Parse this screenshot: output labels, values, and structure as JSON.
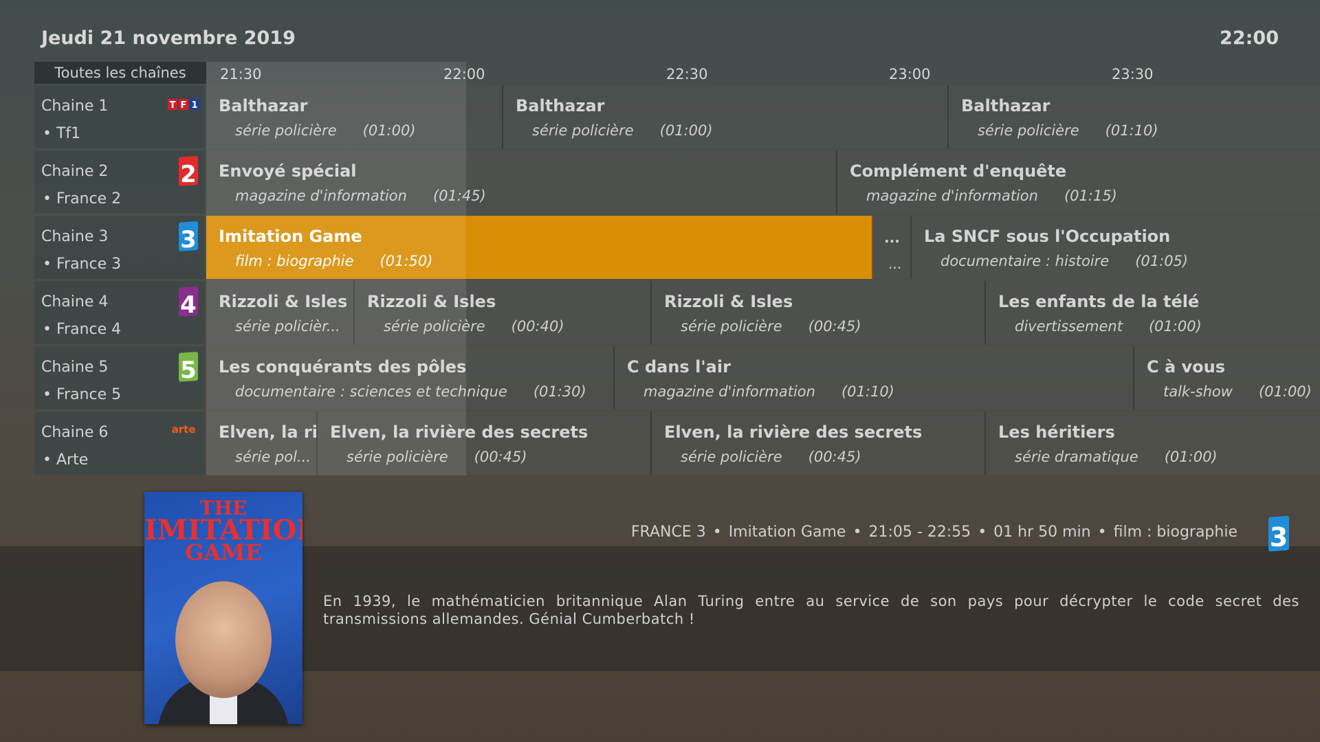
{
  "header": {
    "date": "Jeudi 21 novembre 2019",
    "clock": "22:00"
  },
  "filter": {
    "label": "Toutes les chaînes"
  },
  "timeline": [
    "21:30",
    "22:00",
    "22:30",
    "23:00",
    "23:30"
  ],
  "channels": [
    {
      "number": "Chaine 1",
      "name": "• Tf1",
      "logo": "tf1-logo",
      "logo_text": "TF1"
    },
    {
      "number": "Chaine 2",
      "name": "• France 2",
      "logo": "france2-logo",
      "logo_text": "2"
    },
    {
      "number": "Chaine 3",
      "name": "• France 3",
      "logo": "france3-logo",
      "logo_text": "3"
    },
    {
      "number": "Chaine 4",
      "name": "• France 4",
      "logo": "france4-logo",
      "logo_text": "4"
    },
    {
      "number": "Chaine 5",
      "name": "• France 5",
      "logo": "france5-logo",
      "logo_text": "5"
    },
    {
      "number": "Chaine 6",
      "name": "• Arte",
      "logo": "arte-logo",
      "logo_text": "arte"
    }
  ],
  "programs": {
    "ch1": [
      {
        "title": "Balthazar",
        "genre": "série policière",
        "duration": "(01:00)"
      },
      {
        "title": "Balthazar",
        "genre": "série policière",
        "duration": "(01:00)"
      },
      {
        "title": "Balthazar",
        "genre": "série policière",
        "duration": "(01:10)"
      }
    ],
    "ch2": [
      {
        "title": "Envoyé spécial",
        "genre": "magazine d'information",
        "duration": "(01:45)"
      },
      {
        "title": "Complément d'enquête",
        "genre": "magazine d'information",
        "duration": "(01:15)"
      }
    ],
    "ch3": [
      {
        "title": "Imitation Game",
        "genre": "film : biographie",
        "duration": "(01:50)"
      },
      {
        "title": "...",
        "genre": "..."
      },
      {
        "title": "La SNCF sous l'Occupation",
        "genre": "documentaire : histoire",
        "duration": "(01:05)"
      }
    ],
    "ch4": [
      {
        "title": "Rizzoli & Isles",
        "genre": "série policièr..."
      },
      {
        "title": "Rizzoli & Isles",
        "genre": "série policière",
        "duration": "(00:40)"
      },
      {
        "title": "Rizzoli & Isles",
        "genre": "série policière",
        "duration": "(00:45)"
      },
      {
        "title": "Les enfants de la télé",
        "genre": "divertissement",
        "duration": "(01:00)"
      }
    ],
    "ch5": [
      {
        "title": "Les conquérants des pôles",
        "genre": "documentaire : sciences et technique",
        "duration": "(01:30)"
      },
      {
        "title": "C dans l'air",
        "genre": "magazine d'information",
        "duration": "(01:10)"
      },
      {
        "title": "C à vous",
        "genre": "talk-show",
        "duration": "(01:00)"
      }
    ],
    "ch6": [
      {
        "title": "Elven, la ri...",
        "genre": "série pol..."
      },
      {
        "title": "Elven, la rivière des secrets",
        "genre": "série policière",
        "duration": "(00:45)"
      },
      {
        "title": "Elven, la rivière des secrets",
        "genre": "série policière",
        "duration": "(00:45)"
      },
      {
        "title": "Les héritiers",
        "genre": "série dramatique",
        "duration": "(01:00)"
      }
    ]
  },
  "details": {
    "channel": "FRANCE 3",
    "title": "Imitation Game",
    "time": "21:05 - 22:55",
    "length": "01 hr 50 min",
    "genre": "film : biographie",
    "poster_line1": "THE",
    "poster_line2": "IMITATION",
    "poster_line3": "GAME",
    "description": "En 1939, le mathématicien britannique Alan Turing entre au service de son pays pour décrypter le code secret des transmissions allemandes. Génial Cumberbatch !"
  },
  "colors": {
    "selected": "#d88e05",
    "tf1_red": "#d21e2b",
    "tf1_blue": "#1b3f9c",
    "france2_red": "#e32a2a",
    "france3_blue": "#1f8ed6",
    "france4_purple": "#8a2d8c",
    "france5_green": "#7ab648",
    "arte_orange": "#f25c13"
  }
}
